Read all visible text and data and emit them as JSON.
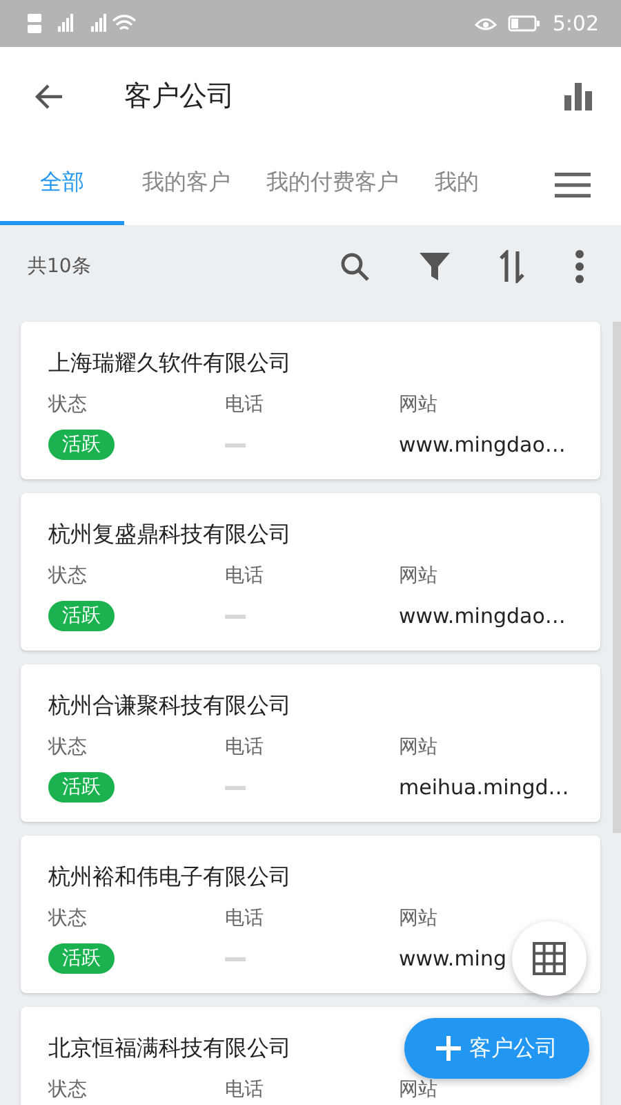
{
  "status_bar": {
    "time": "5:02"
  },
  "app_bar": {
    "title": "客户公司"
  },
  "tabs": [
    {
      "label": "全部",
      "selected": true
    },
    {
      "label": "我的客户",
      "selected": false
    },
    {
      "label": "我的付费客户",
      "selected": false
    },
    {
      "label": "我的",
      "selected": false
    }
  ],
  "toolbar": {
    "count": "共10条"
  },
  "cards": [
    {
      "name": "上海瑞耀久软件有限公司",
      "labels": [
        "状态",
        "电话",
        "网站"
      ],
      "status": {
        "label": "活跃",
        "color": "#19b24f"
      },
      "website": "www.mingdao…"
    },
    {
      "name": "杭州复盛鼎科技有限公司",
      "labels": [
        "状态",
        "电话",
        "网站"
      ],
      "status": {
        "label": "活跃",
        "color": "#19b24f"
      },
      "website": "www.mingdao…"
    },
    {
      "name": "杭州合谦聚科技有限公司",
      "labels": [
        "状态",
        "电话",
        "网站"
      ],
      "status": {
        "label": "活跃",
        "color": "#19b24f"
      },
      "website": "meihua.mingd…"
    },
    {
      "name": "杭州裕和伟电子有限公司",
      "labels": [
        "状态",
        "电话",
        "网站"
      ],
      "status": {
        "label": "活跃",
        "color": "#19b24f"
      },
      "website": "www.ming"
    },
    {
      "name": "北京恒福满科技有限公司",
      "labels": [
        "状态",
        "电话",
        "网站"
      ]
    }
  ],
  "add_button": {
    "label": "客户公司"
  }
}
